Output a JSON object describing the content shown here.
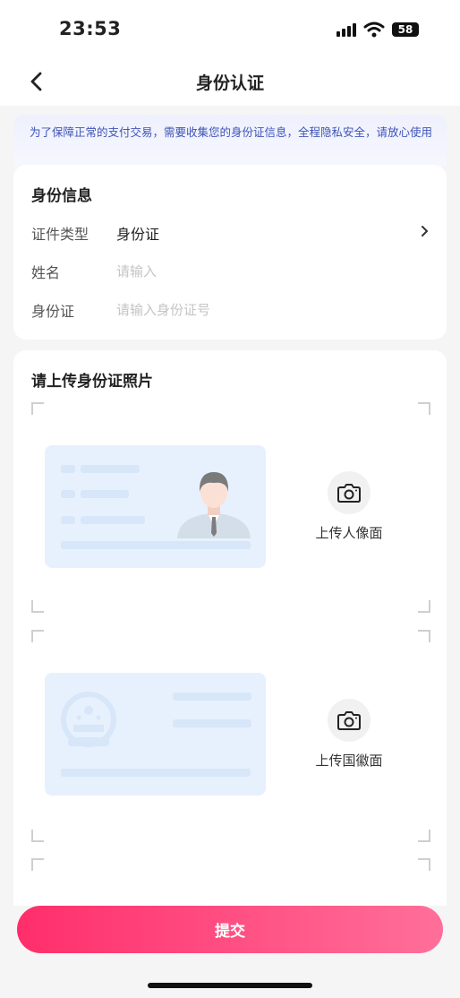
{
  "status": {
    "time": "23:53",
    "battery": "58"
  },
  "nav": {
    "title": "身份认证"
  },
  "notice": "为了保障正常的支付交易，需要收集您的身份证信息，全程隐私安全，请放心使用",
  "identity": {
    "title": "身份信息",
    "type_label": "证件类型",
    "type_value": "身份证",
    "name_label": "姓名",
    "name_placeholder": "请输入",
    "id_label": "身份证",
    "id_placeholder": "请输入身份证号"
  },
  "upload": {
    "title": "请上传身份证照片",
    "front_label": "上传人像面",
    "back_label": "上传国徽面"
  },
  "submit_label": "提交",
  "colors": {
    "accent": "#ff2e6b",
    "notice_text": "#3f55b5",
    "card_placeholder": "#e7f1fd"
  }
}
